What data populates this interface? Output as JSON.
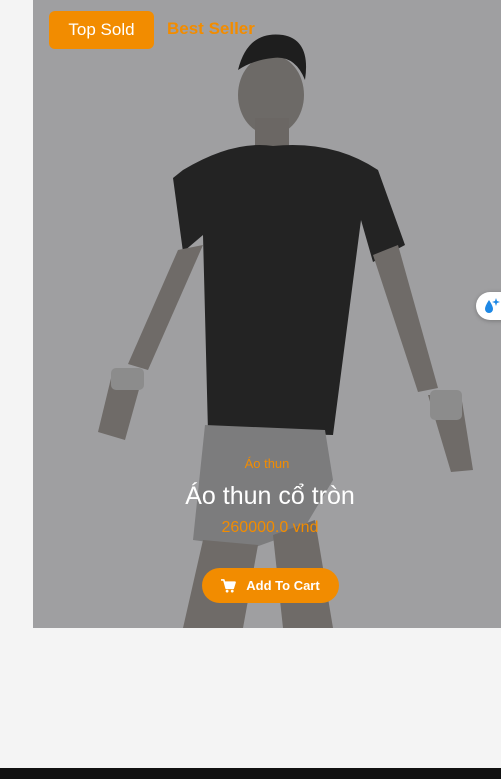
{
  "tabs": {
    "top_sold": "Top Sold",
    "best_seller": "Best Seller"
  },
  "product": {
    "category": "Áo thun",
    "name": "Áo thun cổ tròn",
    "price": "260000.0 vnd",
    "add_to_cart": "Add To Cart"
  },
  "icons": {
    "cart": "cart-icon",
    "widget": "water-drop-sparkle-icon"
  },
  "colors": {
    "accent": "#f28c00",
    "overlay": "#9f9fa1",
    "text_light": "#ffffff"
  }
}
